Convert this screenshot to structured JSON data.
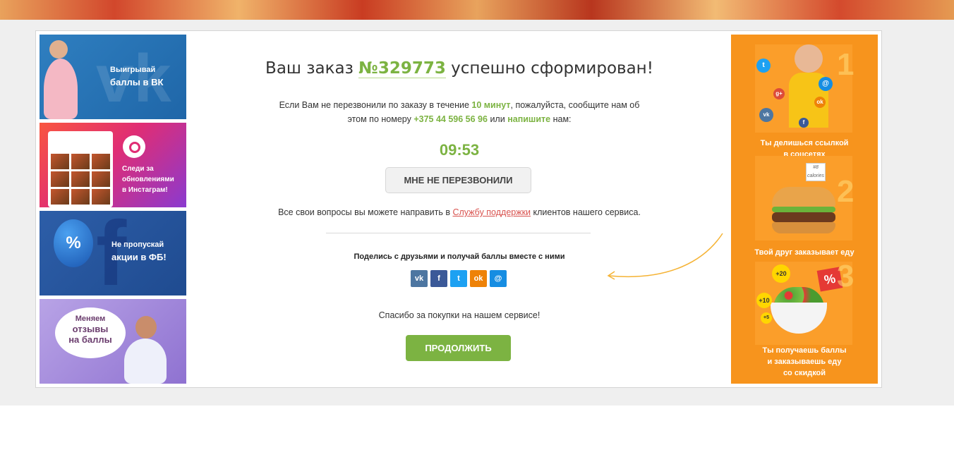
{
  "order": {
    "title_prefix": "Ваш заказ",
    "number": "№329773",
    "title_suffix": "успешно сформирован!"
  },
  "info": {
    "part1": "Если Вам не перезвонили по заказу в течение",
    "minutes": "10 минут",
    "part2": ", пожалуйста, сообщите нам об этом по номеру",
    "phone": "+375 44 596 56 96",
    "part3": "или",
    "write": "напишите",
    "part4": "нам:"
  },
  "timer": "09:53",
  "callback_button": "МНЕ НЕ ПЕРЕЗВОНИЛИ",
  "support": {
    "part1": "Все свои вопросы вы можете направить в",
    "link": "Службу поддержки",
    "part2": "клиентов нашего сервиса."
  },
  "share": {
    "title": "Поделись с друзьями и получай баллы вместе с ними",
    "buttons": [
      {
        "icon": "vk-icon",
        "glyph": "vk"
      },
      {
        "icon": "facebook-icon",
        "glyph": "f"
      },
      {
        "icon": "twitter-icon",
        "glyph": "t"
      },
      {
        "icon": "odnoklassniki-icon",
        "glyph": "ok"
      },
      {
        "icon": "mymail-icon",
        "glyph": "@"
      }
    ]
  },
  "thanks": "Спасибо за покупки на нашем сервисе!",
  "continue_button": "ПРОДОЛЖИТЬ",
  "left_banners": {
    "vk": {
      "line1": "Выигрывай",
      "line2": "баллы в ВК"
    },
    "instagram": {
      "line1": "Следи за",
      "line2": "обновлениями",
      "line3": "в Инстаграм!"
    },
    "facebook": {
      "line1": "Не пропускай",
      "line2": "акции в ФБ!",
      "badge": "%"
    },
    "reviews": {
      "line1": "Меняем",
      "line2": "отзывы",
      "line3": "на баллы"
    }
  },
  "steps": [
    {
      "num": "1",
      "line1": "Ты делишься ссылкой",
      "line2": "в соцсетях"
    },
    {
      "num": "2",
      "line1": "Твой друг заказывает еду"
    },
    {
      "num": "3",
      "line1": "Ты получаешь баллы",
      "line2": "и заказываешь еду",
      "line3": "со скидкой",
      "badges": [
        "+20",
        "+10",
        "+5",
        "%"
      ]
    }
  ],
  "colors": {
    "accent_green": "#7cb342",
    "link_red": "#d9534f",
    "orange_panel": "#f7941d"
  }
}
